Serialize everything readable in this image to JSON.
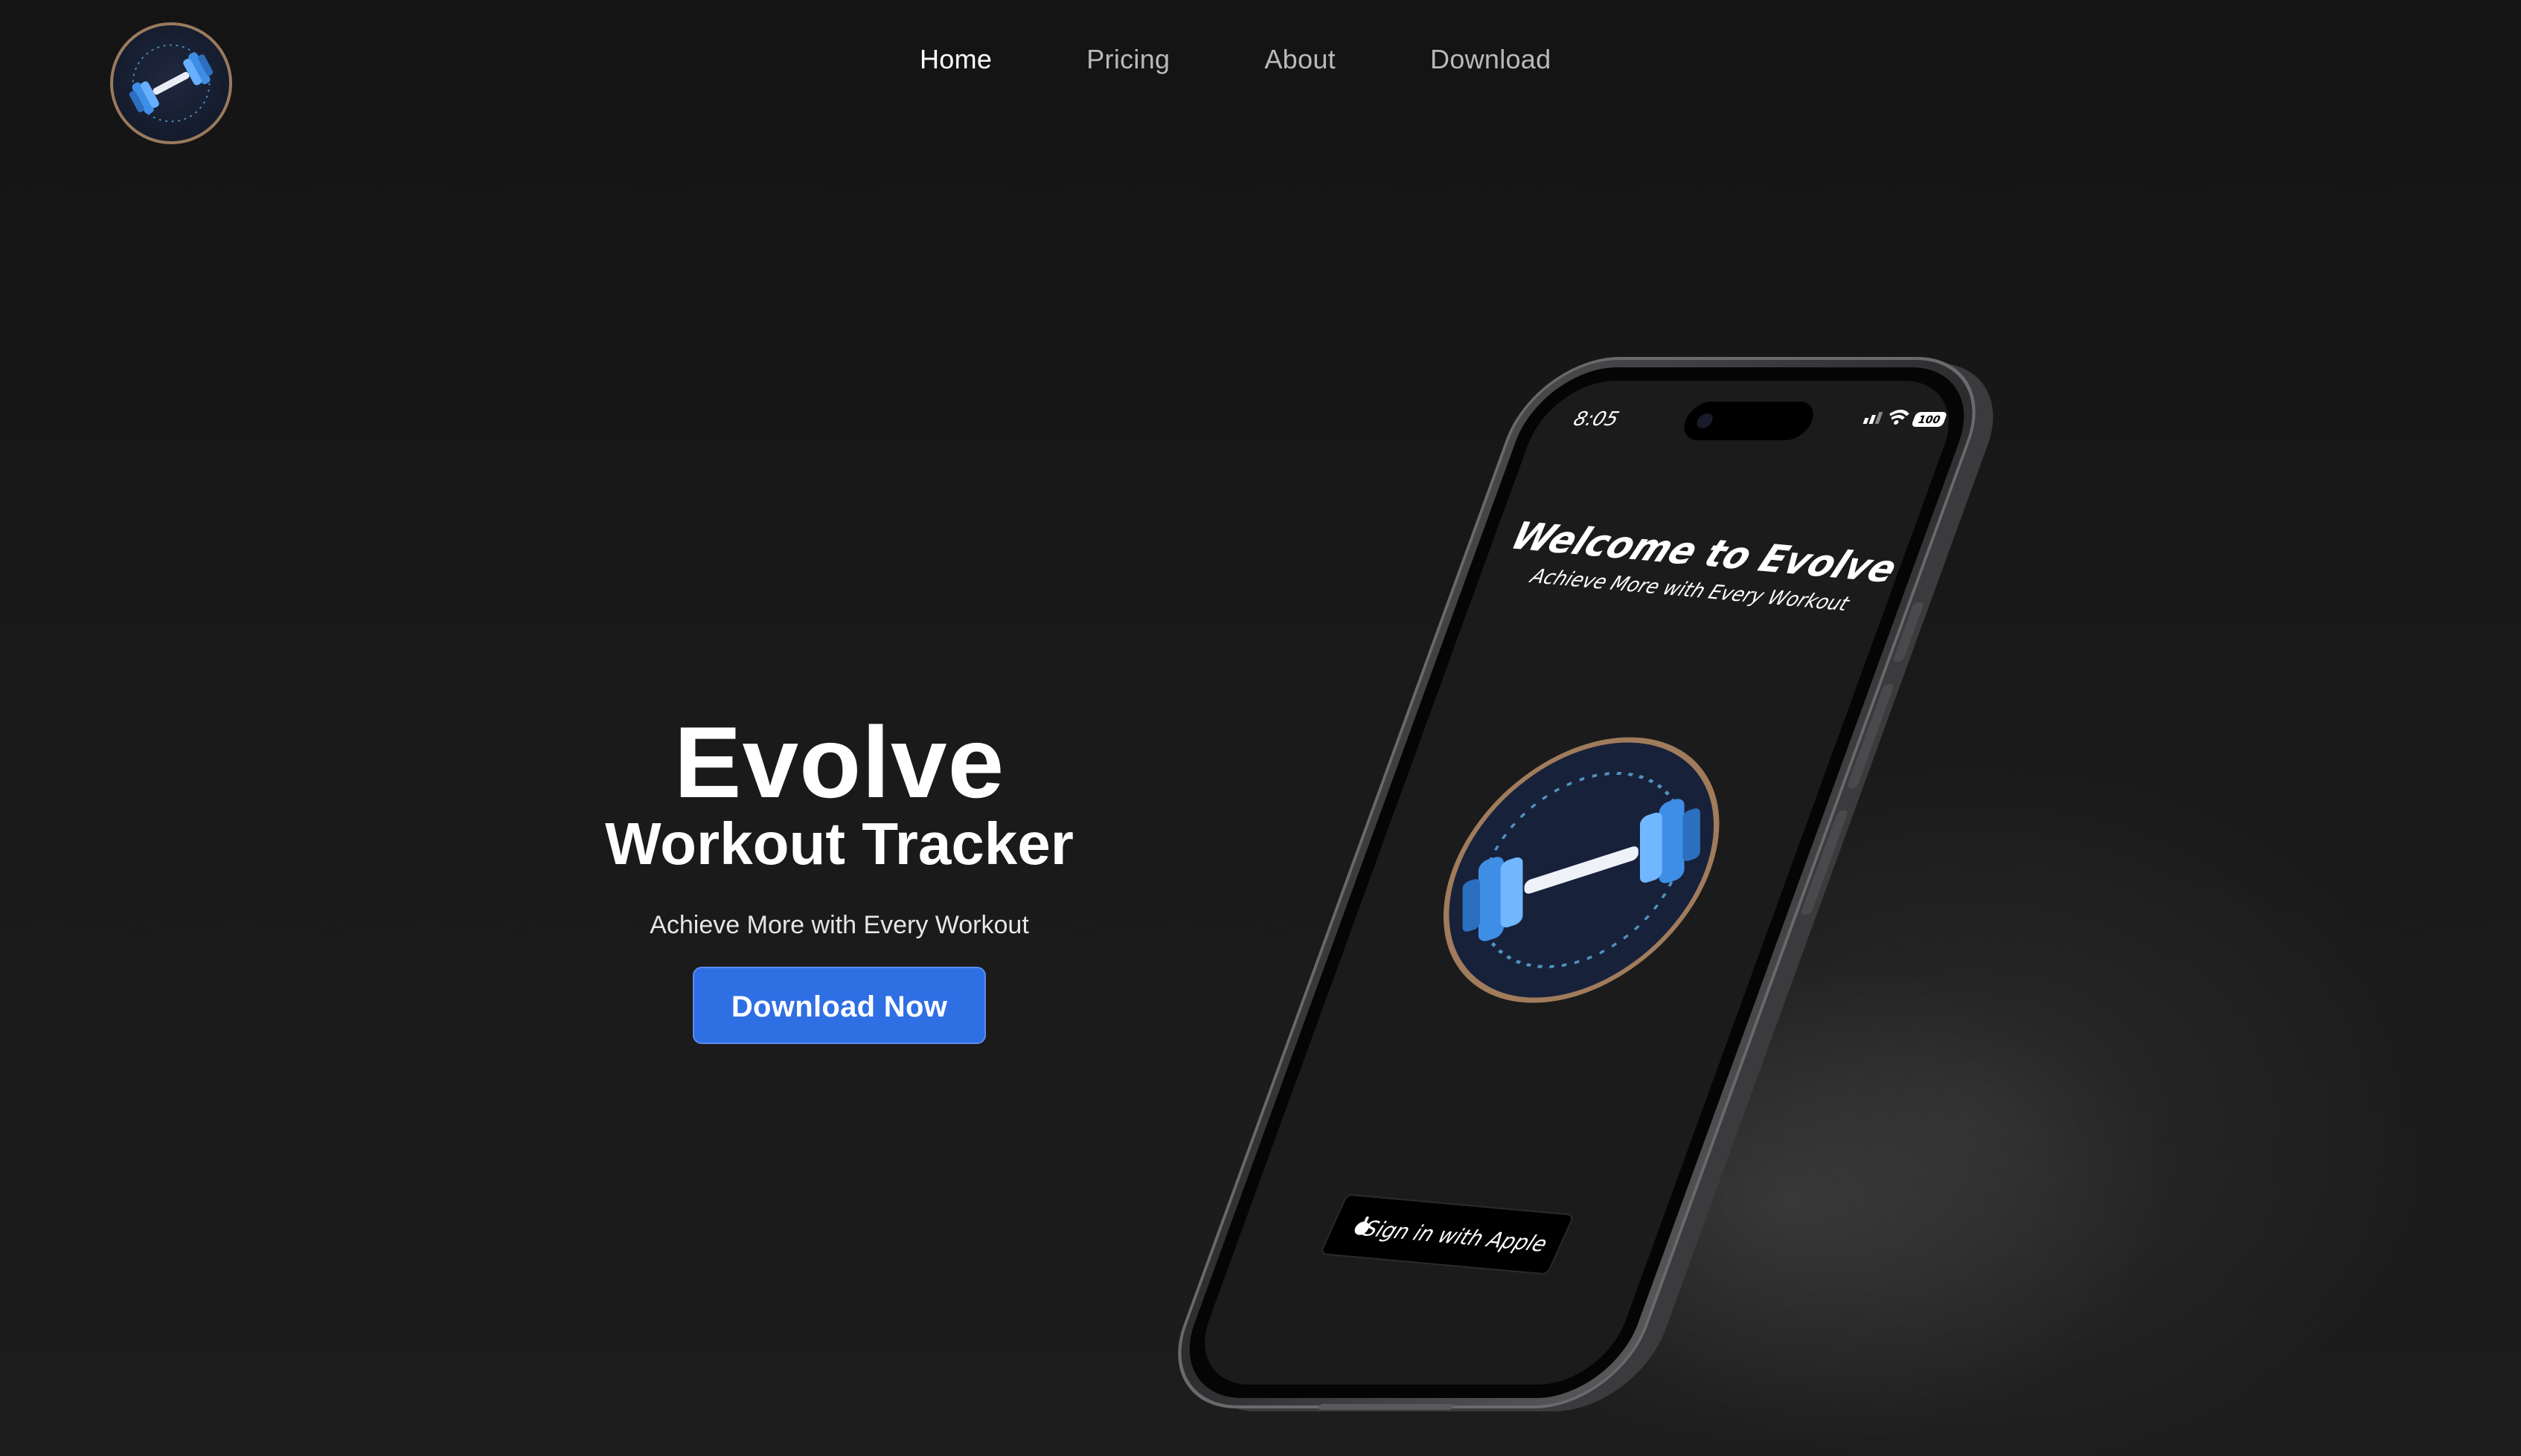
{
  "header": {
    "logo_icon": "dumbbell-icon",
    "nav": [
      {
        "label": "Home",
        "active": true
      },
      {
        "label": "Pricing",
        "active": false
      },
      {
        "label": "About",
        "active": false
      },
      {
        "label": "Download",
        "active": false
      }
    ]
  },
  "hero": {
    "title": "Evolve",
    "subtitle": "Workout Tracker",
    "tagline": "Achieve More with Every Workout",
    "cta_label": "Download Now"
  },
  "phone": {
    "status_time": "8:05",
    "battery": "100",
    "welcome_title": "Welcome to Evolve",
    "welcome_subtitle": "Achieve More with Every Workout",
    "sign_in_label": "Sign in with Apple",
    "sign_in_icon": "apple-icon",
    "app_icon": "dumbbell-icon"
  },
  "colors": {
    "background": "#161616",
    "accent_blue": "#2f6fe4",
    "logo_ring": "#9a7a5e",
    "dumbbell_blue": "#4aa3ff"
  }
}
